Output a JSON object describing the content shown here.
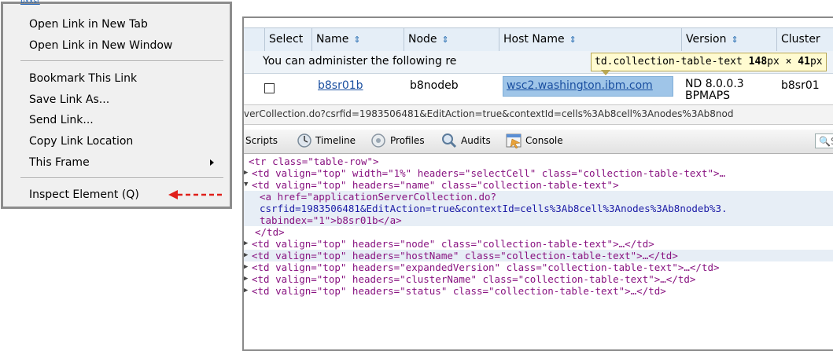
{
  "context_menu": {
    "partial_link_text": "bxxsr",
    "items": [
      {
        "label": "Open Link in New Tab"
      },
      {
        "label": "Open Link in New Window"
      },
      {
        "label": "Bookmark This Link"
      },
      {
        "label": "Save Link As..."
      },
      {
        "label": "Send Link..."
      },
      {
        "label": "Copy Link Location"
      },
      {
        "label": "This Frame"
      },
      {
        "label": "Inspect Element (Q)"
      }
    ],
    "arrow_color": "#e0201b"
  },
  "table": {
    "headers": {
      "select": "Select",
      "name": "Name",
      "node": "Node",
      "host": "Host Name",
      "version": "Version",
      "cluster": "Cluster"
    },
    "sort_icon": "⇕",
    "info_text": "You can administer the following re",
    "row": {
      "name": "b8sr01b",
      "node": "b8nodeb",
      "host": "wsc2.washington.ibm.com",
      "version_line1": "ND 8.0.0.3",
      "version_line2": "BPMAPS",
      "cluster": "b8sr01"
    }
  },
  "tooltip": {
    "selector": "td.collection-table-text",
    "width_value": "148",
    "height_value": "41",
    "unit": "px",
    "times": "×"
  },
  "url_text": "verCollection.do?csrfid=1983506481&EditAction=true&contextId=cells%3Ab8cell%3Anodes%3Ab8nod",
  "devtools": {
    "tabs": [
      {
        "label": "Scripts"
      },
      {
        "label": "Timeline"
      },
      {
        "label": "Profiles"
      },
      {
        "label": "Audits"
      },
      {
        "label": "Console"
      }
    ],
    "search_placeholder": "S",
    "code_lines": [
      {
        "text": "<tr class=\"table-row\">"
      },
      {
        "text": "<td valign=\"top\" width=\"1%\" headers=\"selectCell\" class=\"collection-table-text\">…"
      },
      {
        "text": "<td valign=\"top\" headers=\"name\" class=\"collection-table-text\">"
      },
      {
        "text": "<a href=\"applicationServerCollection.do?"
      },
      {
        "text": "csrfid=1983506481&EditAction=true&contextId=cells%3Ab8cell%3Anodes%3Ab8nodeb%3."
      },
      {
        "text": "tabindex=\"1\">b8sr01b</a>"
      },
      {
        "text": "</td>"
      },
      {
        "text": "<td valign=\"top\" headers=\"node\" class=\"collection-table-text\">…</td>"
      },
      {
        "text": "<td valign=\"top\" headers=\"hostName\" class=\"collection-table-text\">…</td>"
      },
      {
        "text": "<td valign=\"top\" headers=\"expandedVersion\" class=\"collection-table-text\">…</td>"
      },
      {
        "text": "<td valign=\"top\" headers=\"clusterName\" class=\"collection-table-text\">…</td>"
      },
      {
        "text": "<td valign=\"top\" headers=\"status\" class=\"collection-table-text\">…</td>"
      }
    ]
  }
}
